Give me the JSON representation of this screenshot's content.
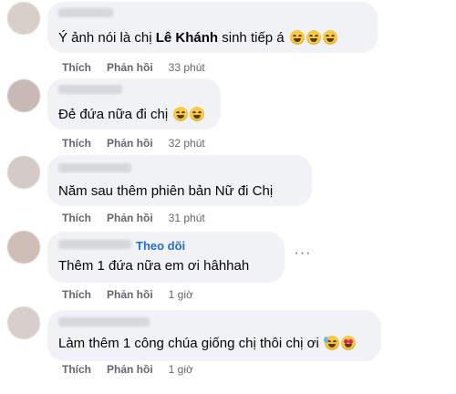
{
  "comments": [
    {
      "text_before": "Ý ảnh nói là chị ",
      "text_bold": "Lê Khánh",
      "text_after": " sinh tiếp á",
      "emojis": [
        "grinning-sweat-face-emoji",
        "grinning-sweat-face-emoji",
        "grinning-sweat-face-emoji"
      ],
      "like_label": "Thích",
      "reply_label": "Phản hồi",
      "time": "33 phút"
    },
    {
      "text": "Đẻ đứa nữa đi chị",
      "emojis": [
        "grinning-face-emoji",
        "grinning-face-emoji"
      ],
      "like_label": "Thích",
      "reply_label": "Phản hồi",
      "time": "32 phút"
    },
    {
      "text": "Năm sau thêm phiên bản Nữ đi Chị",
      "like_label": "Thích",
      "reply_label": "Phản hồi",
      "time": "31 phút"
    },
    {
      "text": "Thêm 1 đứa nữa em ơi hâhhah",
      "follow_label": "Theo dõi",
      "more_label": "···",
      "like_label": "Thích",
      "reply_label": "Phản hồi",
      "time": "1 giờ"
    },
    {
      "text": "Làm thêm 1 công chúa giống chị thôi chị ơi",
      "emojis": [
        "sweat-smile-emoji",
        "heart-eyes-emoji"
      ],
      "like_label": "Thích",
      "reply_label": "Phản hồi",
      "time": "1 giờ"
    }
  ],
  "colors": {
    "bubble": "#f0f2f5",
    "action_text": "#65676b",
    "follow_link": "#216fdb"
  }
}
